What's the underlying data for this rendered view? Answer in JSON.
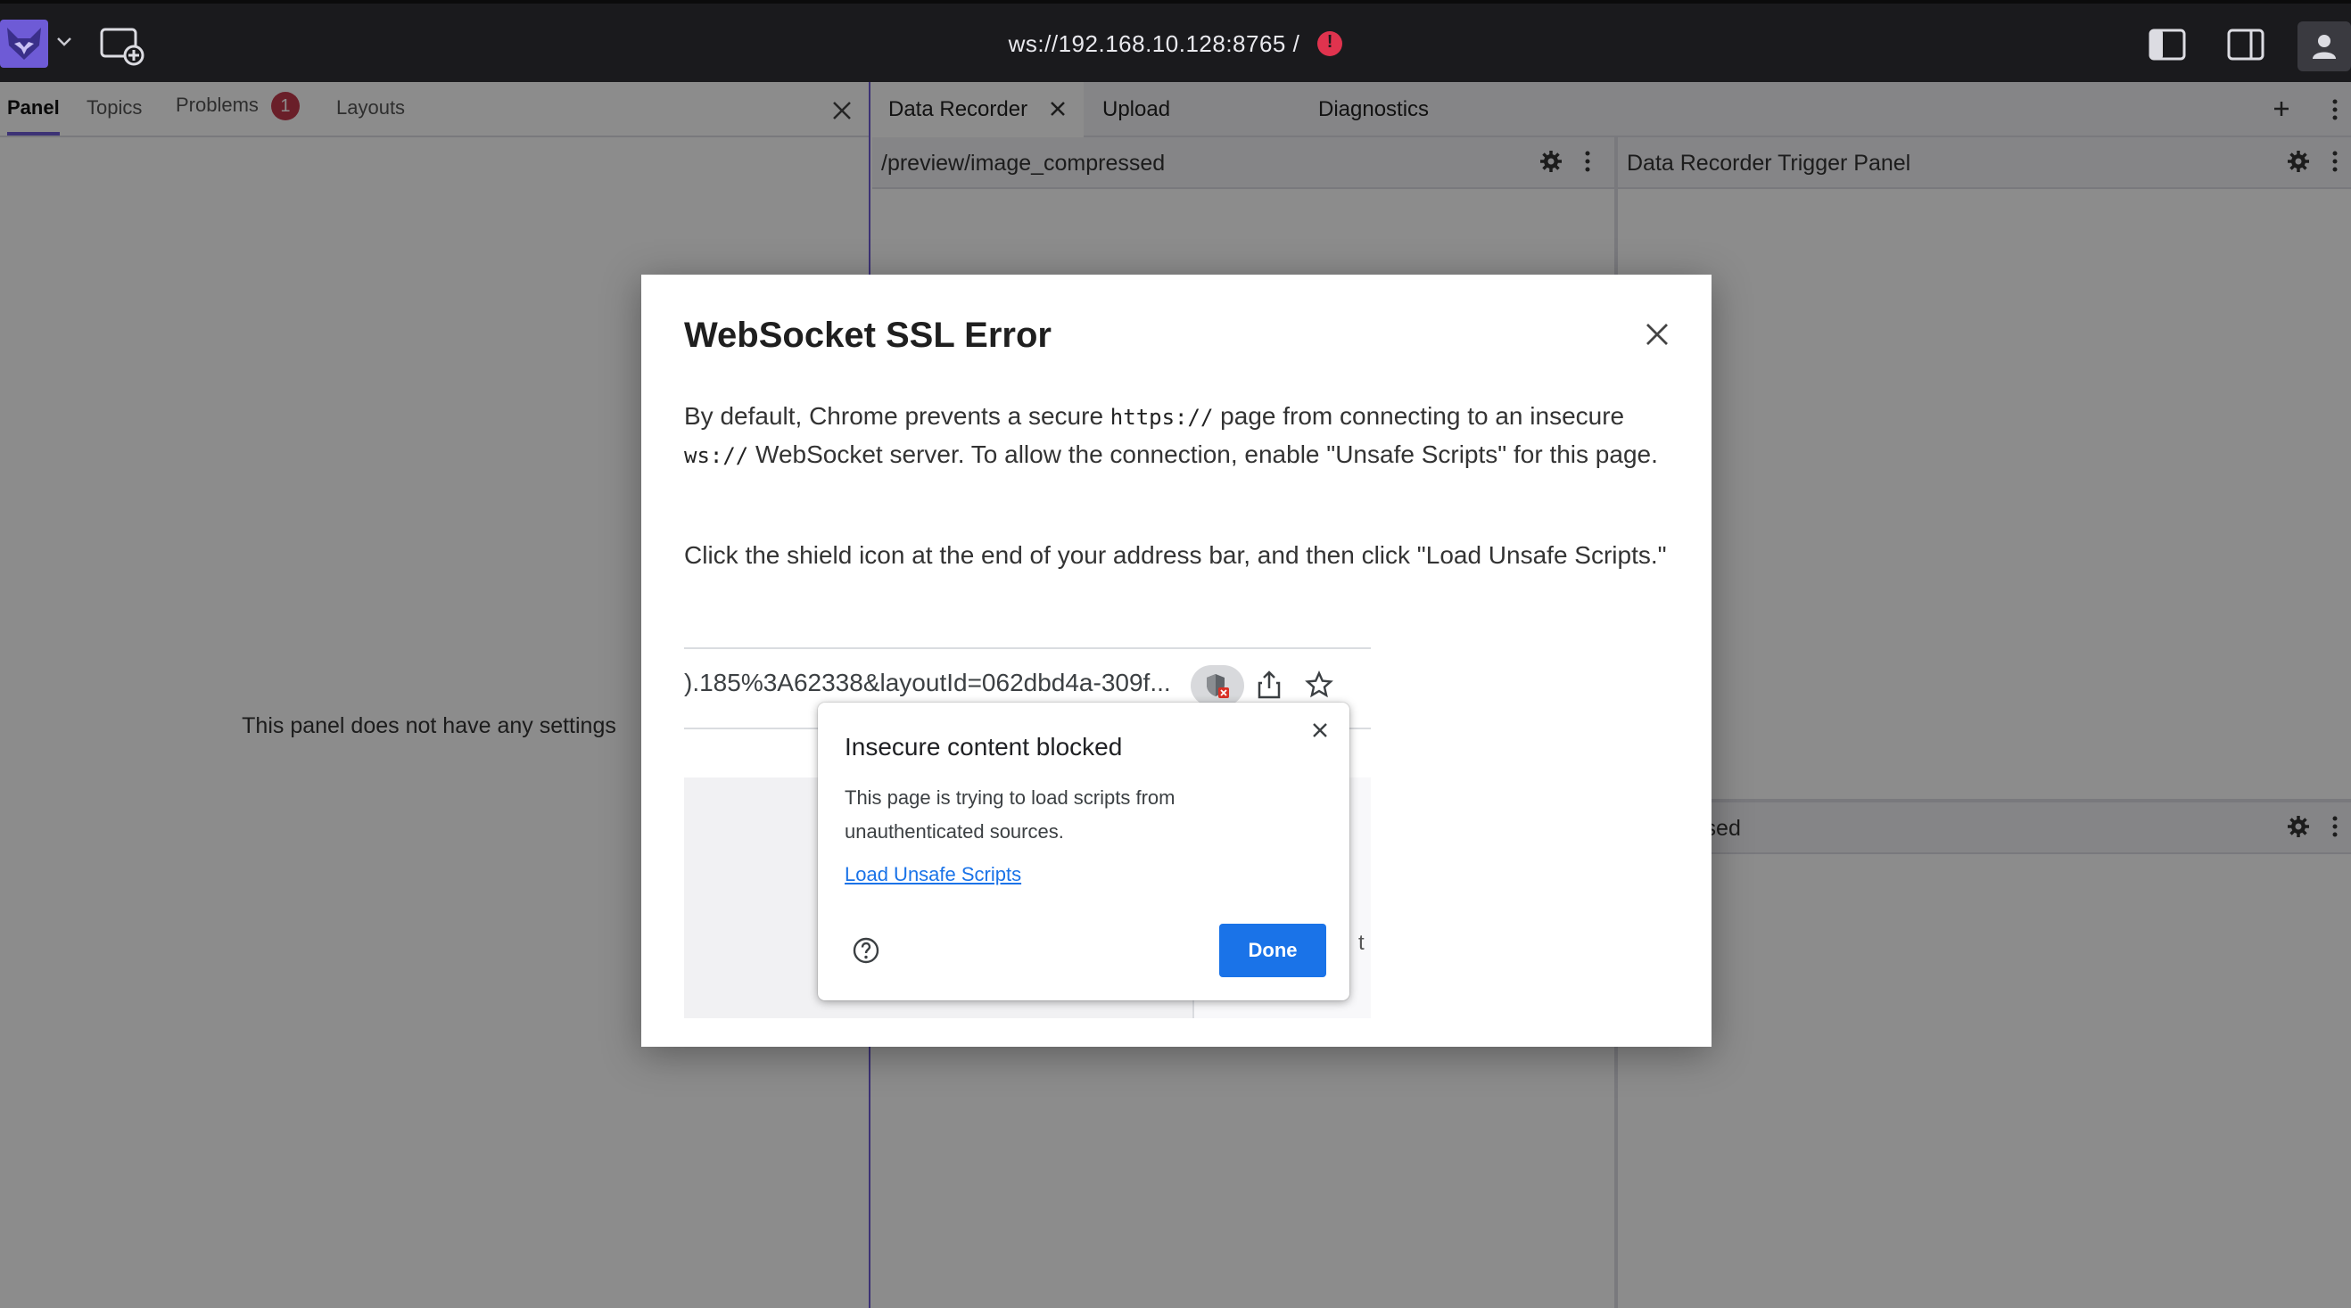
{
  "topbar": {
    "connection": "ws://192.168.10.128:8765 /"
  },
  "left_panel": {
    "tabs": [
      {
        "label": "Panel"
      },
      {
        "label": "Topics"
      },
      {
        "label": "Problems",
        "badge": "1"
      },
      {
        "label": "Layouts"
      }
    ],
    "message": "This panel does not have any settings"
  },
  "workspace": {
    "tabs": [
      {
        "label": "Data Recorder"
      },
      {
        "label": "Upload"
      },
      {
        "label": "Diagnostics"
      }
    ],
    "panels": {
      "top_left": "/preview/image_compressed",
      "top_right": "Data Recorder Trigger Panel",
      "bottom_right": "y_info.used"
    }
  },
  "modal": {
    "title": "WebSocket SSL Error",
    "p1_a": "By default, Chrome prevents a secure ",
    "p1_code1": "https://",
    "p1_b": " page from connecting to an insecure ",
    "p1_code2": "ws://",
    "p1_c": " WebSocket server. To allow the connection, enable \"Unsafe Scripts\" for this page.",
    "p2": "Click the shield icon at the end of your address bar, and then click \"Load Unsafe Scripts.\"",
    "screenshot": {
      "url_fragment": ").185%3A62338&layoutId=062dbd4a-309f...",
      "ghost_text": "t",
      "popup": {
        "title": "Insecure content blocked",
        "body": "This page is trying to load scripts from unauthenticated sources.",
        "link": "Load Unsafe Scripts",
        "done": "Done"
      }
    }
  },
  "colors": {
    "accent": "#6e5bd6",
    "error": "#e0334e",
    "badge": "#c23a4c",
    "chrome_blue": "#1a73e8",
    "topbar": "#1a1a1d"
  }
}
